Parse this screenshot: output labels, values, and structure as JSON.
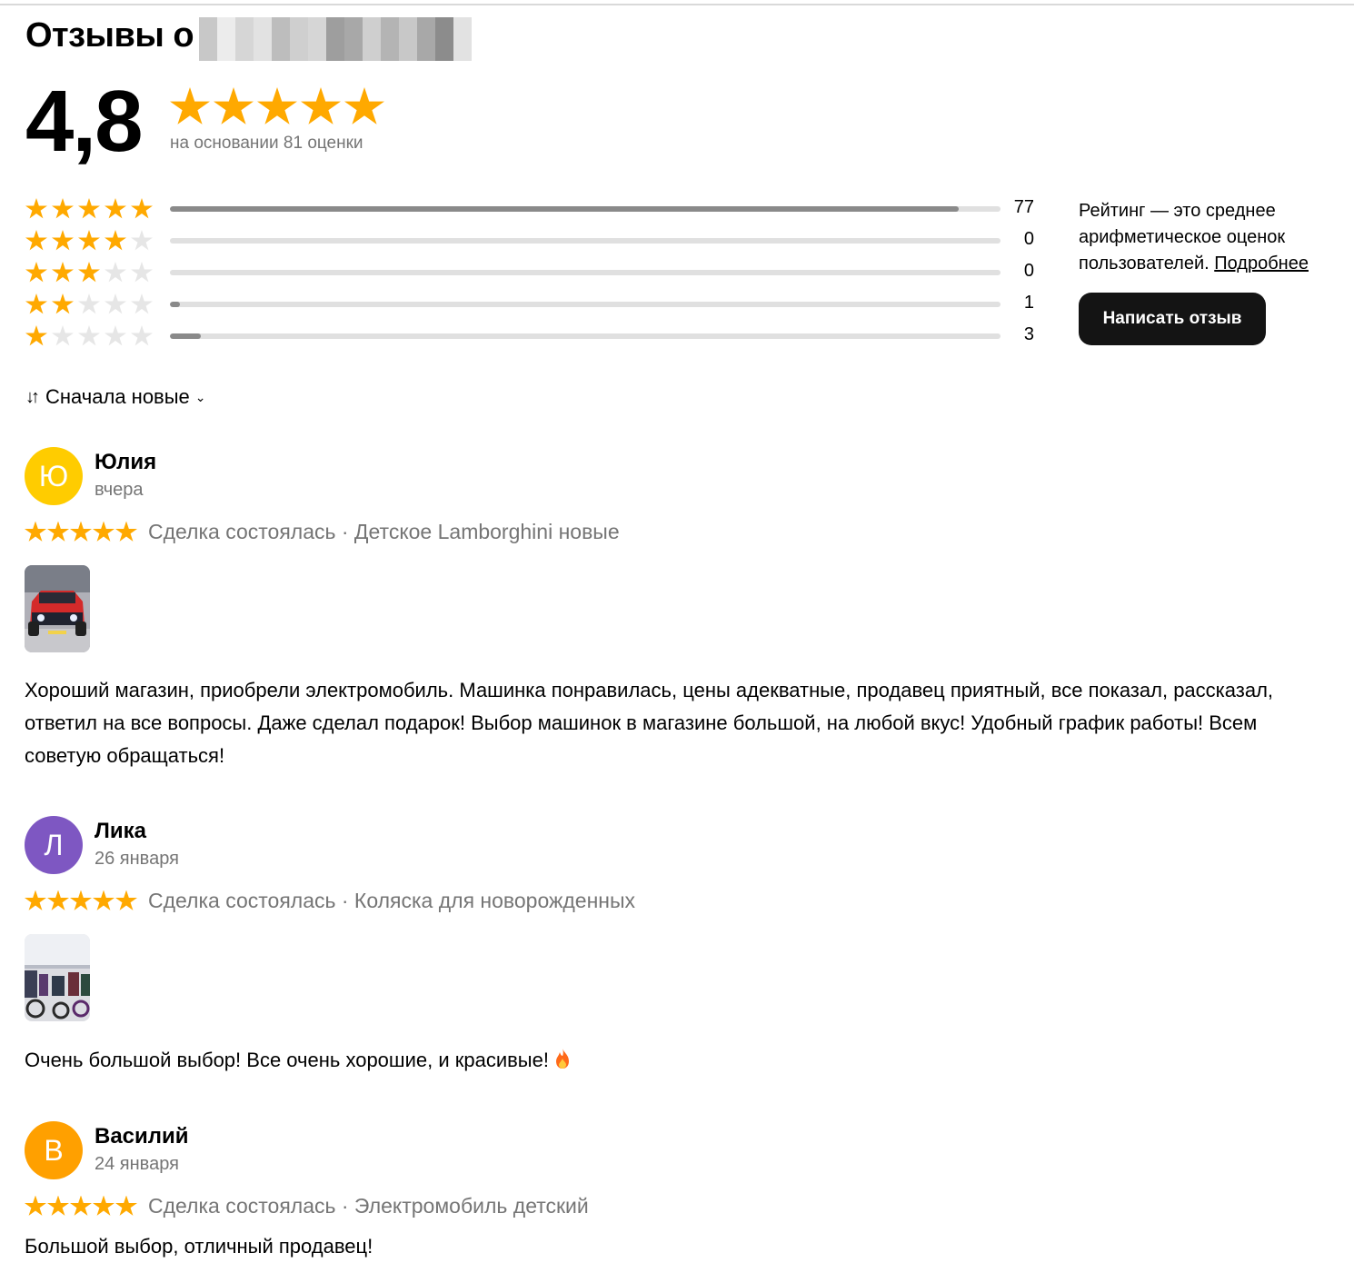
{
  "header": {
    "title": "Отзывы о"
  },
  "summary": {
    "rating": "4,8",
    "stars_filled": 5,
    "based_on": "на основании 81 оценки",
    "distribution": [
      {
        "stars": 5,
        "count": "77",
        "fraction": 0.95
      },
      {
        "stars": 4,
        "count": "0",
        "fraction": 0
      },
      {
        "stars": 3,
        "count": "0",
        "fraction": 0
      },
      {
        "stars": 2,
        "count": "1",
        "fraction": 0.012
      },
      {
        "stars": 1,
        "count": "3",
        "fraction": 0.037
      }
    ],
    "info_text": "Рейтинг — это среднее арифметическое оценок пользователей.",
    "info_link": "Подробнее",
    "write_button": "Написать отзыв"
  },
  "sort": {
    "label": "Сначала новые"
  },
  "reviews": [
    {
      "initial": "Ю",
      "avatar_color": "#ffcc00",
      "name": "Юлия",
      "date": "вчера",
      "stars": 5,
      "meta": "Сделка состоялась · Детское Lamborghini новые",
      "has_photo": true,
      "photo_icon": "red-toy-car-photo",
      "text": "Хороший магазин, приобрели электромобиль. Машинка понравилась, цены адекватные, продавец приятный, все показал, рассказал, ответил на все вопросы. Даже сделал подарок! Выбор машинок в магазине большой, на любой вкус! Удобный график работы! Всем советую обращаться!"
    },
    {
      "initial": "Л",
      "avatar_color": "#7e57c2",
      "name": "Лика",
      "date": "26 января",
      "stars": 5,
      "meta": "Сделка состоялась · Коляска для новорожденных",
      "has_photo": true,
      "photo_icon": "store-interior-photo",
      "text": "Очень большой выбор! Все очень хорошие, и красивые!",
      "emoji": "fire-icon"
    },
    {
      "initial": "В",
      "avatar_color": "#ffa000",
      "name": "Василий",
      "date": "24 января",
      "stars": 5,
      "meta": "Сделка состоялась · Электромобиль детский",
      "has_photo": false,
      "text": "Большой выбор, отличный продавец!"
    }
  ],
  "colors": {
    "star": "#ffa900",
    "star_empty": "#e6e6e6",
    "button": "#141414",
    "muted": "#757575"
  }
}
